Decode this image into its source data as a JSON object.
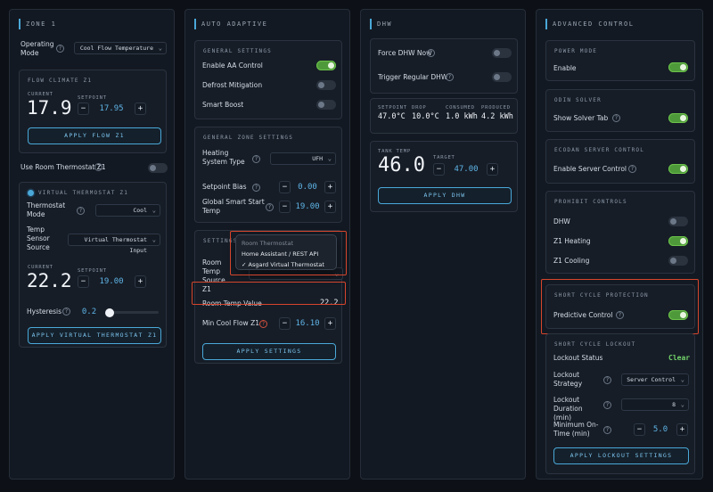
{
  "zone1": {
    "title": "ZONE 1",
    "operating_mode_label": "Operating Mode",
    "operating_mode_value": "Cool Flow Temperature",
    "flow_climate": {
      "title": "FLOW CLIMATE Z1",
      "current_label": "CURRENT",
      "current_value": "17.9",
      "setpoint_label": "SETPOINT",
      "setpoint_value": "17.95",
      "apply_label": "APPLY FLOW Z1"
    },
    "use_room_thermostat_label": "Use Room Thermostat Z1",
    "virtual_thermostat": {
      "title": "VIRTUAL THERMOSTAT Z1",
      "mode_label": "Thermostat Mode",
      "mode_value": "Cool",
      "sensor_label": "Temp Sensor Source",
      "sensor_value": "Virtual Thermostat Input",
      "current_label": "CURRENT",
      "current_value": "22.2",
      "setpoint_label": "SETPOINT",
      "setpoint_value": "19.00",
      "hysteresis_label": "Hysteresis",
      "hysteresis_value": "0.2",
      "apply_label": "APPLY VIRTUAL THERMOSTAT Z1"
    }
  },
  "auto_adaptive": {
    "title": "AUTO ADAPTIVE",
    "general": {
      "title": "GENERAL SETTINGS",
      "enable_aa_label": "Enable AA Control",
      "defrost_label": "Defrost Mitigation",
      "smart_boost_label": "Smart Boost"
    },
    "zone_settings": {
      "title": "GENERAL ZONE SETTINGS",
      "heating_type_label": "Heating System Type",
      "heating_type_value": "UFH",
      "setpoint_bias_label": "Setpoint Bias",
      "setpoint_bias_value": "0.00",
      "smart_start_label": "Global Smart Start Temp",
      "smart_start_value": "19.00"
    },
    "settings_z1_title": "SETTINGS Z1",
    "room_temp_source_label": "Room Temp Source Z1",
    "dropdown": {
      "header": "Room Thermostat",
      "option1": "Home Assistant / REST API",
      "option2": "Asgard Virtual Thermostat",
      "check": "✓"
    },
    "room_temp_value_label": "Room Temp Value",
    "room_temp_value": "22.2",
    "min_cool_flow_label": "Min Cool Flow Z1",
    "min_cool_flow_value": "16.10",
    "apply_label": "APPLY SETTINGS"
  },
  "dhw": {
    "title": "DHW",
    "force_label": "Force DHW Now",
    "trigger_label": "Trigger Regular DHW",
    "stats": {
      "setpoint_label": "SETPOINT",
      "setpoint_value": "47.0°C",
      "drop_label": "DROP",
      "drop_value": "10.0°C",
      "consumed_label": "CONSUMED",
      "consumed_value": "1.0 kWh",
      "produced_label": "PRODUCED",
      "produced_value": "4.2 kWh"
    },
    "tank": {
      "tank_label": "TANK TEMP",
      "tank_value": "46.0",
      "target_label": "TARGET",
      "target_value": "47.00",
      "apply_label": "APPLY DHW"
    }
  },
  "advanced": {
    "title": "ADVANCED CONTROL",
    "power_mode": {
      "title": "POWER MODE",
      "enable_label": "Enable"
    },
    "odin": {
      "title": "ODIN SOLVER",
      "show_label": "Show Solver Tab"
    },
    "ecodan": {
      "title": "ECODAN SERVER CONTROL",
      "enable_label": "Enable Server Control"
    },
    "prohibit": {
      "title": "PROHIBIT CONTROLS",
      "dhw_label": "DHW",
      "z1_heating_label": "Z1 Heating",
      "z1_cooling_label": "Z1 Cooling"
    },
    "short_cycle": {
      "title": "SHORT CYCLE PROTECTION",
      "predictive_label": "Predictive Control"
    },
    "lockout": {
      "title": "SHORT CYCLE LOCKOUT",
      "status_label": "Lockout Status",
      "status_value": "Clear",
      "strategy_label": "Lockout Strategy",
      "strategy_value": "Server Control",
      "duration_label": "Lockout Duration (min)",
      "duration_value": "8",
      "min_on_label": "Minimum On-Time (min)",
      "min_on_value": "5.0",
      "apply_label": "APPLY LOCKOUT SETTINGS"
    }
  },
  "common": {
    "minus": "−",
    "plus": "+",
    "help": "?",
    "chev": "⌄"
  }
}
